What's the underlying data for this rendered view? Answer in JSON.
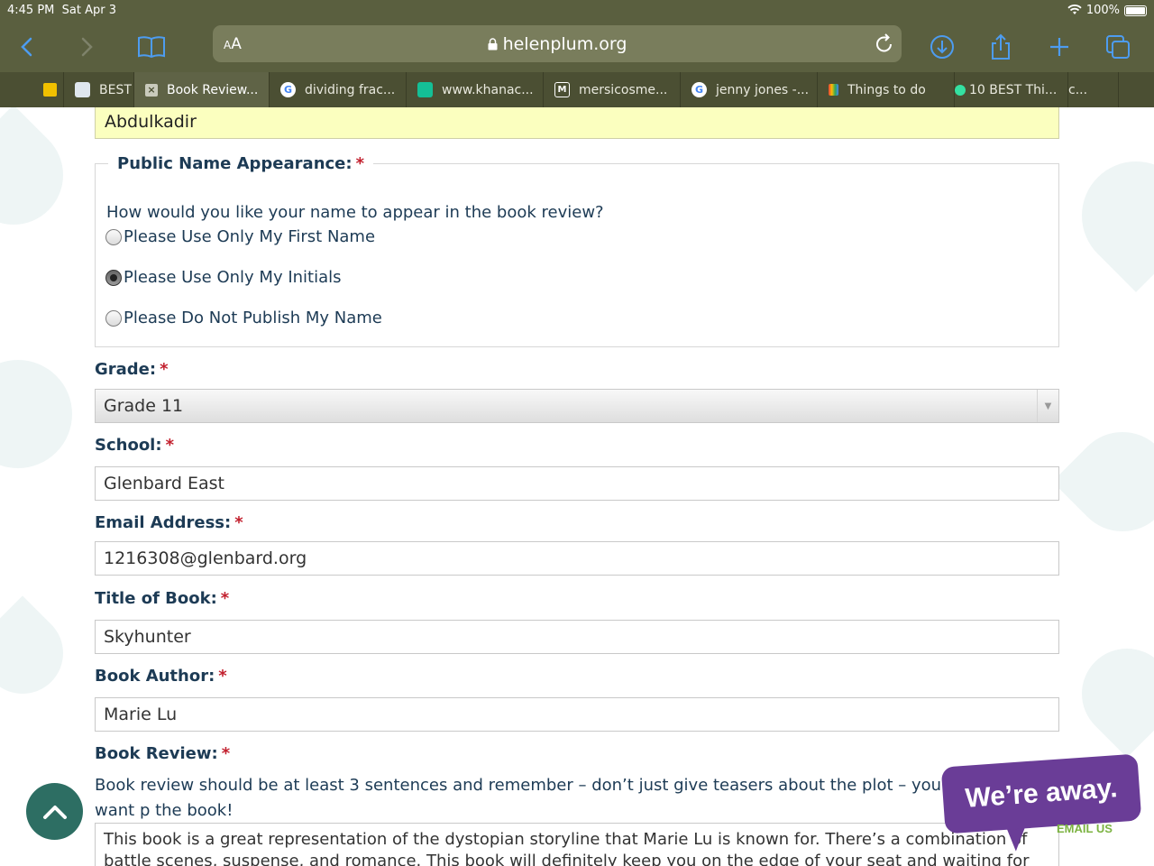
{
  "status_bar": {
    "time": "4:45 PM",
    "date": "Sat Apr 3",
    "battery": "100%"
  },
  "browser": {
    "text_size_label": "AA",
    "url": "helenplum.org",
    "tabs": [
      {
        "label": "BEST"
      },
      {
        "label": "Book Review..."
      },
      {
        "label": "dividing frac..."
      },
      {
        "label": "www.khanac..."
      },
      {
        "label": "mersicosme..."
      },
      {
        "label": "jenny jones -..."
      },
      {
        "label": "Things to do"
      },
      {
        "label": "10 BEST Thi..."
      },
      {
        "label": "c..."
      }
    ]
  },
  "form": {
    "name_value": "Abdulkadir",
    "public_name": {
      "legend": "Public Name Appearance:",
      "question": "How would you like your name to appear in the book review?",
      "options": [
        {
          "label": "Please Use Only My First Name",
          "checked": false
        },
        {
          "label": "Please Use Only My Initials",
          "checked": true
        },
        {
          "label": "Please Do Not Publish My Name",
          "checked": false
        }
      ]
    },
    "grade": {
      "label": "Grade:",
      "value": "Grade 11"
    },
    "school": {
      "label": "School:",
      "value": "Glenbard East"
    },
    "email": {
      "label": "Email Address:",
      "value": "1216308@glenbard.org"
    },
    "title": {
      "label": "Title of Book:",
      "value": "Skyhunter"
    },
    "author": {
      "label": "Book Author:",
      "value": "Marie Lu"
    },
    "review": {
      "label": "Book Review:",
      "help": "Book review should be at least 3 sentences and remember – don’t just give teasers about the plot – you want p the book!",
      "value": "This book is a great representation of the dystopian storyline that Marie Lu is known for. There’s a combination of battle scenes, suspense, and romance. This book will definitely keep you on the edge of your seat and waiting for the next"
    },
    "required_mark": "*"
  },
  "chat_widget": {
    "title": "We’re away.",
    "link": "EMAIL US"
  },
  "colors": {
    "label": "#1d3b55",
    "required": "#c21f2d",
    "toolbar": "#5a5f3f",
    "accent": "#2d6e63",
    "chat": "#6a3d97"
  }
}
